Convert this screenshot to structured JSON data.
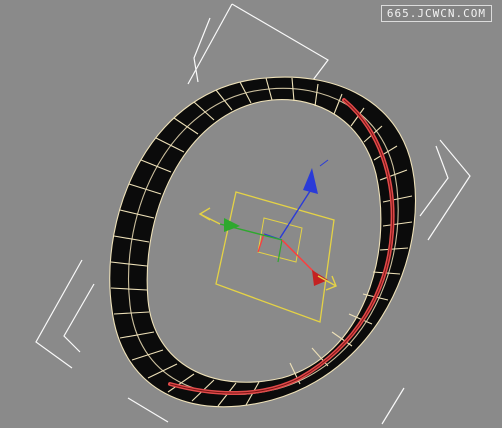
{
  "watermark": "665.JCWCN.COM",
  "viewport": {
    "background": "#8a8a8a"
  },
  "colors": {
    "bounding_box": "#ffffff",
    "wireframe": "#eee1b8",
    "ring_interior": "#0b0b0b",
    "selected_edge": "#e04a4a",
    "gizmo_plane": "#e4d246",
    "axis_x": "#ff3b3b",
    "axis_y": "#2ea82e",
    "axis_z": "#2a3bd8",
    "axis_handle": "#e4d246"
  },
  "icons": [
    "transform-gizmo-icon",
    "x-axis-arrow-icon",
    "y-axis-arrow-icon",
    "z-axis-arrow-icon"
  ]
}
